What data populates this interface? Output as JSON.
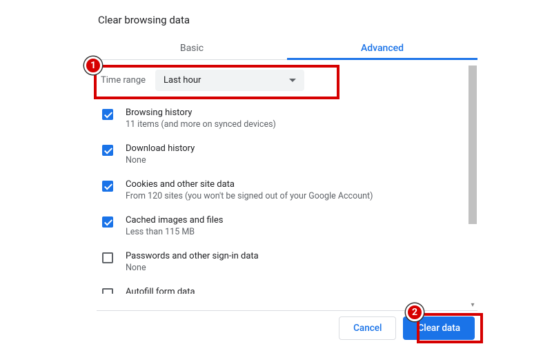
{
  "dialog": {
    "title": "Clear browsing data",
    "tabs": {
      "basic": "Basic",
      "advanced": "Advanced"
    },
    "timerange": {
      "label": "Time range",
      "value": "Last hour"
    },
    "options": [
      {
        "title": "Browsing history",
        "sub": "11 items (and more on synced devices)",
        "checked": true
      },
      {
        "title": "Download history",
        "sub": "None",
        "checked": true
      },
      {
        "title": "Cookies and other site data",
        "sub": "From 120 sites (you won't be signed out of your Google Account)",
        "checked": true
      },
      {
        "title": "Cached images and files",
        "sub": "Less than 115 MB",
        "checked": true
      },
      {
        "title": "Passwords and other sign-in data",
        "sub": "None",
        "checked": false
      },
      {
        "title": "Autofill form data",
        "sub": "",
        "checked": false
      }
    ],
    "buttons": {
      "cancel": "Cancel",
      "clear": "Clear data"
    }
  },
  "callouts": {
    "one": "1",
    "two": "2"
  }
}
